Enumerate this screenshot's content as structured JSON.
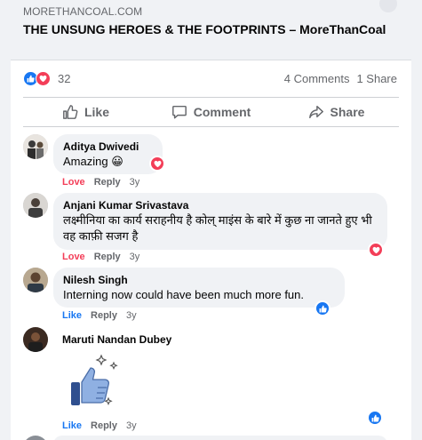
{
  "link": {
    "domain": "MORETHANCOAL.COM",
    "title": "THE UNSUNG HEROES & THE FOOTPRINTS – MoreThanCoal"
  },
  "reactions": {
    "count": "32"
  },
  "stats": {
    "comments": "4 Comments",
    "shares": "1 Share"
  },
  "actions": {
    "like": "Like",
    "comment": "Comment",
    "share": "Share"
  },
  "comments": [
    {
      "name": "Aditya Dwivedi",
      "text": "Amazing 😀",
      "reaction_label": "Love",
      "reply": "Reply",
      "time": "3y",
      "reaction_badge": "heart-icon"
    },
    {
      "name": "Anjani Kumar Srivastava",
      "text": "लक्ष्मीनिया का कार्य सराहनीय है कोल् माइंस के बारे में कुछ ना जानते हुए भी वह काफ़ी सजग है",
      "reaction_label": "Love",
      "reply": "Reply",
      "time": "3y",
      "reaction_badge": "heart-icon"
    },
    {
      "name": "Nilesh Singh",
      "text": "Interning now could have been much more fun.",
      "reaction_label": "Like",
      "reply": "Reply",
      "time": "3y",
      "reaction_badge": "thumbs-up-icon"
    },
    {
      "name": "Maruti Nandan Dubey",
      "reaction_label": "Like",
      "reply": "Reply",
      "time": "3y",
      "reaction_badge": "thumbs-up-icon",
      "sticker": "thumbs-up-sticker"
    }
  ],
  "colors": {
    "brand_blue": "#1877f2",
    "love_red": "#f33e58",
    "secondary_text": "#65676b"
  }
}
